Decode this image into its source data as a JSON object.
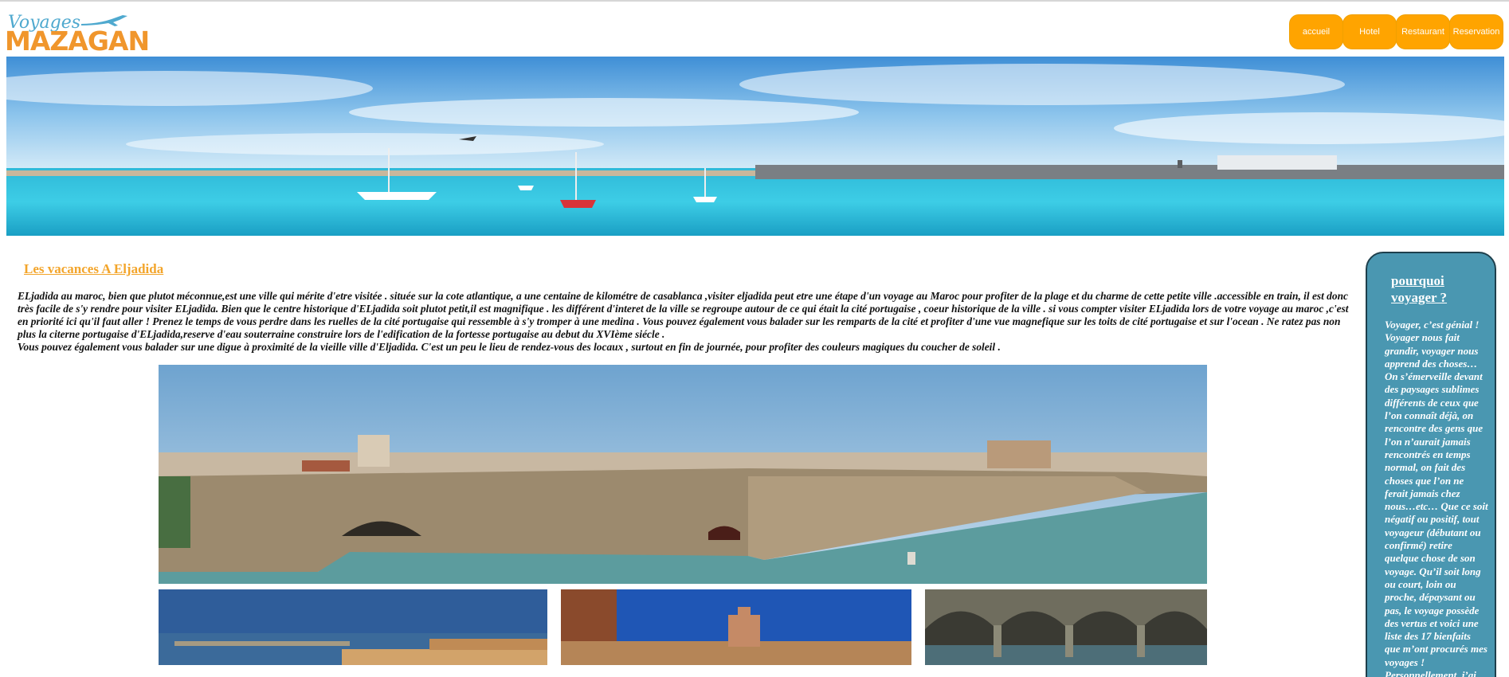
{
  "logo": {
    "top_text": "Voyages",
    "main_text": "MAZAGAN",
    "icon": "airplane-icon"
  },
  "nav": {
    "items": [
      "accueil",
      "Hotel",
      "Restaurant",
      "Reservation"
    ]
  },
  "banner": {
    "alt": "harbor-panorama-image"
  },
  "article": {
    "title": "Les vacances A Eljadida",
    "paragraph_1": "ELjadida au maroc, bien que plutot méconnue,est une ville qui mérite d'etre visitée . située sur la cote atlantique, a une centaine de kilométre de casablanca ,visiter eljadida peut etre une étape d'un voyage au Maroc pour profiter de la plage et du charme de cette petite ville .accessible en train, il est donc très facile de s'y rendre pour visiter ELjadida. Bien que le centre historique d'ELjadida soit plutot petit,il est magnifique . les différent d'interet de la ville se regroupe autour de ce qui était la cité portugaise , coeur historique de la ville . si vous compter visiter ELjadida lors de votre voyage au maroc ,c'est en priorité ici qu'il faut aller ! Prenez le temps de vous perdre dans les ruelles de la cité portugaise qui ressemble à s'y tromper à une medina . Vous pouvez également vous balader sur les remparts de la cité et profiter d'une vue magnefique sur les toits de cité portugaise et sur l'ocean . Ne ratez pas non plus la citerne portugaise d'ELjadida,reserve d'eau souterraine construire lors de l'edification de la fortesse portugaise au debut du XVIème siécle .",
    "paragraph_2": "Vous pouvez également vous balader sur une digue à proximité de la vieille ville d'Eljadida. C'est un peu le lieu de rendez-vous des locaux , surtout en fin de journée, pour profiter des couleurs magiques du coucher de soleil ."
  },
  "aside": {
    "title": "pourquoi voyager ?",
    "text": "Voyager, c’est génial ! Voyager nous fait grandir, voyager nous apprend des choses… On s’émerveille devant des paysages sublimes différents de ceux que l’on connaît déjà, on rencontre des gens que l’on n’aurait jamais rencontrés en temps normal, on fait des choses que l’on ne ferait jamais chez nous…etc… Que ce soit négatif ou positif, tout voyageur (débutant ou confirmé) retire quelque chose de son voyage. Qu’il soit long ou court, loin ou proche, dépaysant ou pas, le voyage possède des vertus et voici une liste des 17 bienfaits que m’ont procurés mes voyages ! Personnellement, j’ai énormément appris au fil de mes voyages"
  },
  "colors": {
    "nav_bg": "#ffa400",
    "title_orange": "#f3a52b",
    "aside_bg": "#4a97b1"
  }
}
